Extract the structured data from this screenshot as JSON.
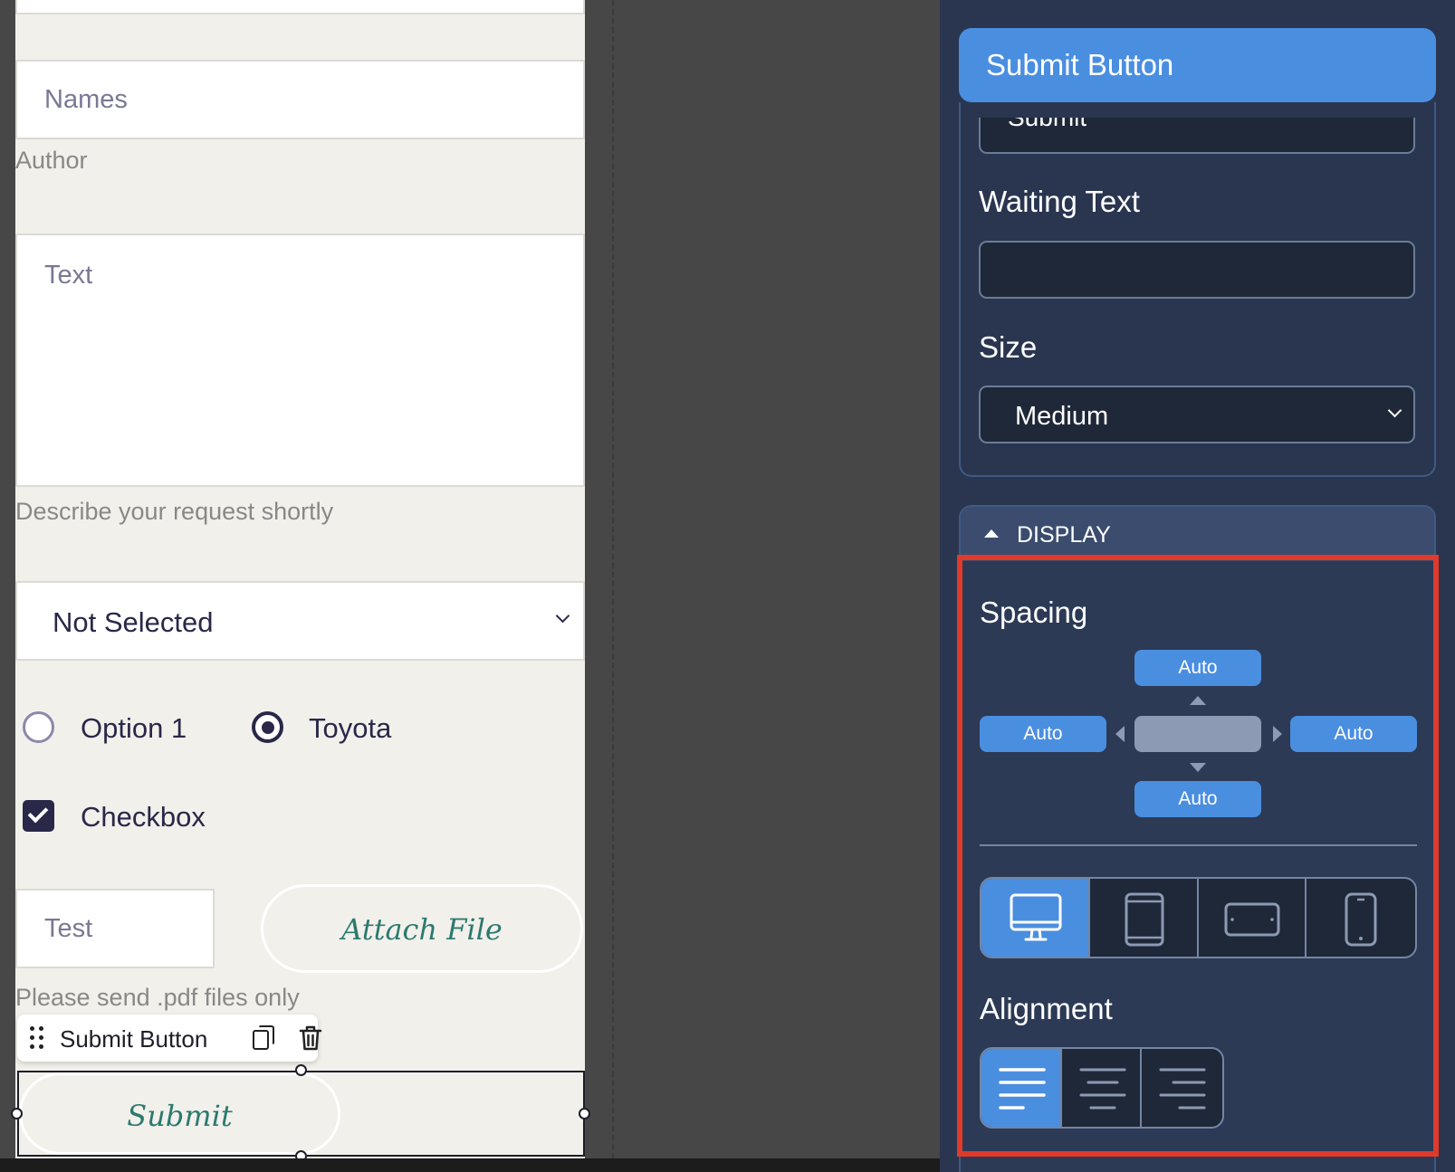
{
  "form": {
    "names_placeholder": "Names",
    "author_label": "Author",
    "text_placeholder": "Text",
    "text_hint": "Describe your request shortly",
    "select_value": "Not Selected",
    "radio_options": [
      "Option 1",
      "Toyota"
    ],
    "radio_selected": "Toyota",
    "checkbox_label": "Checkbox",
    "checkbox_checked": true,
    "test_placeholder": "Test",
    "attach_label": "Attach File",
    "attach_hint": "Please send .pdf files only",
    "submit_label": "Submit"
  },
  "toolbar": {
    "label": "Submit Button",
    "icons": [
      "drag-handle-icon",
      "copy-icon",
      "trash-icon"
    ]
  },
  "panel": {
    "title": "Submit Button",
    "button_text_value": "Submit",
    "waiting_text_label": "Waiting Text",
    "waiting_text_value": "",
    "size_label": "Size",
    "size_value": "Medium",
    "display_section": "DISPLAY",
    "spacing_label": "Spacing",
    "spacing": {
      "top": "Auto",
      "left": "Auto",
      "right": "Auto",
      "bottom": "Auto"
    },
    "devices": [
      "desktop-icon",
      "tablet-icon",
      "tablet-landscape-icon",
      "phone-icon"
    ],
    "device_selected": "desktop-icon",
    "alignment_label": "Alignment",
    "alignments": [
      "align-left-icon",
      "align-center-icon",
      "align-right-icon"
    ],
    "alignment_selected": "align-left-icon"
  },
  "colors": {
    "accent": "#4a8ee0",
    "panel_bg": "#2a3650",
    "highlight_border": "#e03a2b",
    "form_text": "#2a2848",
    "button_text": "#2b7a6e"
  }
}
